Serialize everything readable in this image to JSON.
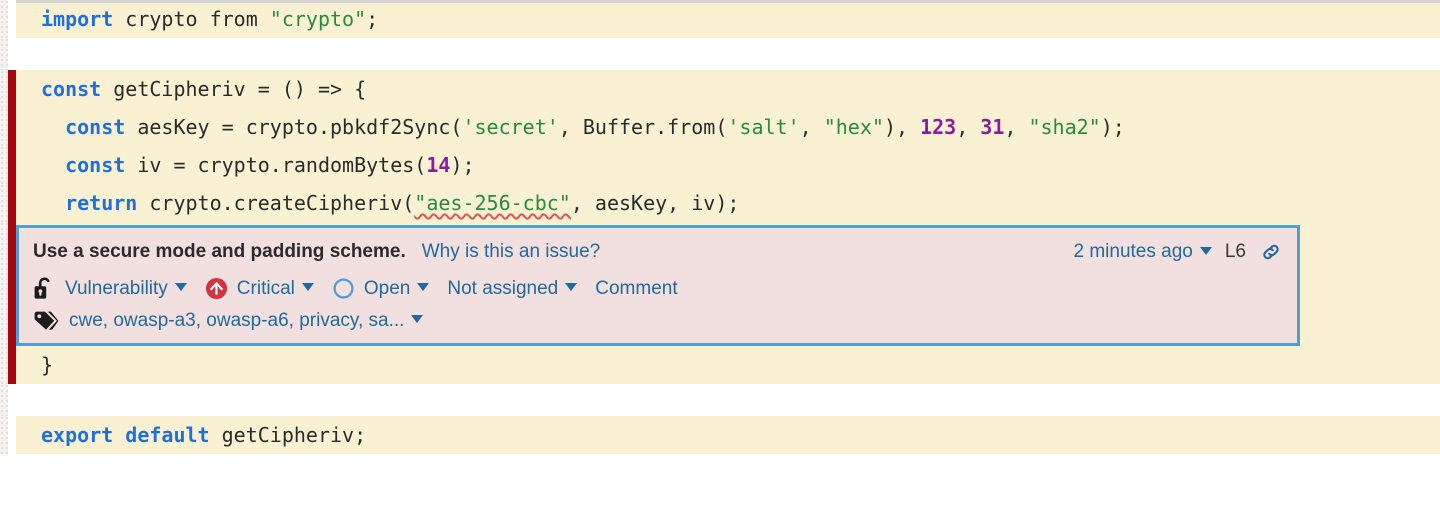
{
  "code": {
    "language": "javascript",
    "lines": [
      {
        "id": "l1",
        "type": "code",
        "flagged": false,
        "tokens": [
          {
            "t": "kw",
            "v": "import"
          },
          {
            "t": "pln",
            "v": " crypto from "
          },
          {
            "t": "str",
            "v": "\"crypto\""
          },
          {
            "t": "pln",
            "v": ";"
          }
        ],
        "plain": "import crypto from \"crypto\";"
      },
      {
        "id": "l2",
        "type": "blank",
        "flagged": false,
        "plain": ""
      },
      {
        "id": "l3",
        "type": "code",
        "flagged": true,
        "tokens": [
          {
            "t": "kw",
            "v": "const"
          },
          {
            "t": "pln",
            "v": " getCipheriv = () => {"
          }
        ],
        "plain": "const getCipheriv = () => {"
      },
      {
        "id": "l4",
        "type": "code",
        "flagged": true,
        "tokens": [
          {
            "t": "pln",
            "v": "  "
          },
          {
            "t": "kw",
            "v": "const"
          },
          {
            "t": "pln",
            "v": " aesKey = crypto.pbkdf2Sync("
          },
          {
            "t": "str",
            "v": "'secret'"
          },
          {
            "t": "pln",
            "v": ", Buffer.from("
          },
          {
            "t": "str",
            "v": "'salt'"
          },
          {
            "t": "pln",
            "v": ", "
          },
          {
            "t": "str",
            "v": "\"hex\""
          },
          {
            "t": "pln",
            "v": "), "
          },
          {
            "t": "num",
            "v": "123"
          },
          {
            "t": "pln",
            "v": ", "
          },
          {
            "t": "num",
            "v": "31"
          },
          {
            "t": "pln",
            "v": ", "
          },
          {
            "t": "str",
            "v": "\"sha2\""
          },
          {
            "t": "pln",
            "v": ");"
          }
        ],
        "plain": "  const aesKey = crypto.pbkdf2Sync('secret', Buffer.from('salt', \"hex\"), 123, 31, \"sha2\");"
      },
      {
        "id": "l5",
        "type": "code",
        "flagged": true,
        "tokens": [
          {
            "t": "pln",
            "v": "  "
          },
          {
            "t": "kw",
            "v": "const"
          },
          {
            "t": "pln",
            "v": " iv = crypto.randomBytes("
          },
          {
            "t": "num",
            "v": "14"
          },
          {
            "t": "pln",
            "v": ");"
          }
        ],
        "plain": "  const iv = crypto.randomBytes(14);"
      },
      {
        "id": "l6",
        "type": "code",
        "flagged": true,
        "tokens": [
          {
            "t": "pln",
            "v": "  "
          },
          {
            "t": "kw",
            "v": "return"
          },
          {
            "t": "pln",
            "v": " crypto.createCipheriv("
          },
          {
            "t": "sq",
            "v": "\"aes-256-cbc\""
          },
          {
            "t": "pln",
            "v": ", aesKey, iv);"
          }
        ],
        "plain": "  return crypto.createCipheriv(\"aes-256-cbc\", aesKey, iv);"
      },
      {
        "id": "l7",
        "type": "code",
        "flagged": false,
        "tokens": [
          {
            "t": "pln",
            "v": "}"
          }
        ],
        "plain": "}"
      },
      {
        "id": "l8",
        "type": "blank",
        "flagged": false,
        "plain": ""
      },
      {
        "id": "l9",
        "type": "code",
        "flagged": false,
        "tokens": [
          {
            "t": "kw",
            "v": "export default"
          },
          {
            "t": "pln",
            "v": " getCipheriv;"
          }
        ],
        "plain": "export default getCipheriv;"
      }
    ]
  },
  "issue": {
    "title": "Use a secure mode and padding scheme.",
    "why_link": "Why is this an issue?",
    "age": "2 minutes ago",
    "line_label": "L6",
    "permalink_icon": "link-chain-icon",
    "type": {
      "label": "Vulnerability",
      "icon": "open-padlock-icon",
      "has_caret": true
    },
    "severity": {
      "label": "Critical",
      "icon": "severity-critical-arrow-up-icon",
      "color": "#d4333f",
      "has_caret": true
    },
    "status": {
      "label": "Open",
      "icon": "open-circle-icon",
      "color": "#4f9ed4",
      "has_caret": true
    },
    "assignee": {
      "label": "Not assigned",
      "has_caret": true
    },
    "comment": {
      "label": "Comment"
    },
    "tags": {
      "icon": "tag-icon",
      "label": "cwe, owasp-a3, owasp-a6, privacy, sa...",
      "has_caret": true
    },
    "colors": {
      "box_border": "#4f9ed4",
      "box_background": "#f2dfdf",
      "link": "#236a9b",
      "flag_bar": "#a4070e",
      "code_background": "#faf0d2"
    }
  }
}
